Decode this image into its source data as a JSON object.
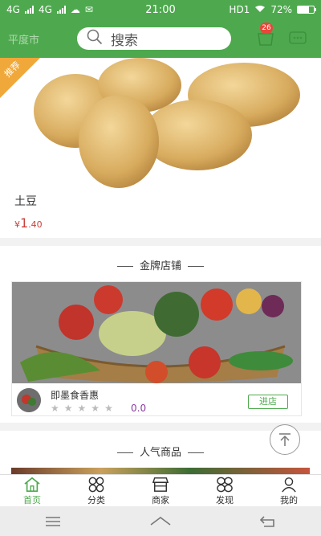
{
  "status_bar": {
    "left": [
      "4G",
      "4G"
    ],
    "time": "21:00",
    "right": [
      "HD1",
      "72%"
    ]
  },
  "header": {
    "city": "平度市",
    "search_placeholder": "搜索",
    "cart_badge": "26"
  },
  "product": {
    "ribbon": "推荐",
    "name": "土豆",
    "price_symbol": "¥",
    "price_whole": "1",
    "price_cents": ".40"
  },
  "shops": {
    "title": "金牌店铺",
    "card": {
      "name": "即墨食香惠",
      "rating": "0.0",
      "enter_label": "进店"
    }
  },
  "popular": {
    "title": "人气商品"
  },
  "tabbar": {
    "tabs": [
      {
        "label": "首页",
        "icon": "home-icon"
      },
      {
        "label": "分类",
        "icon": "category-icon"
      },
      {
        "label": "商家",
        "icon": "store-icon"
      },
      {
        "label": "发现",
        "icon": "discover-icon"
      },
      {
        "label": "我的",
        "icon": "profile-icon"
      }
    ]
  },
  "colors": {
    "primary": "#4ea94e",
    "badge": "#e8463b",
    "price": "#c8413d",
    "ribbon": "#f0a83a"
  }
}
